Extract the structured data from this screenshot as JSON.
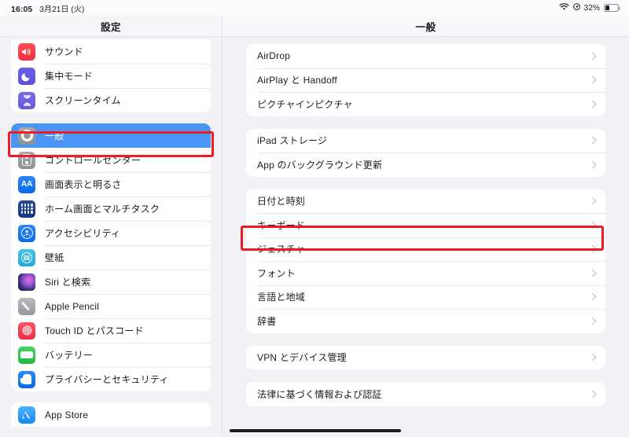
{
  "status_bar": {
    "time": "16:05",
    "date": "3月21日 (火)",
    "wifi_icon": "wifi-icon",
    "location_icon": "location-services-icon",
    "battery_percent": "32%",
    "battery_icon": "battery-icon"
  },
  "header": {
    "sidebar_title": "設定",
    "detail_title": "一般"
  },
  "sidebar": {
    "groups": [
      {
        "items": [
          {
            "label": "サウンド",
            "icon": "speaker-icon",
            "icon_class": "ic-sound",
            "selected": false
          },
          {
            "label": "集中モード",
            "icon": "moon-icon",
            "icon_class": "ic-focus",
            "selected": false
          },
          {
            "label": "スクリーンタイム",
            "icon": "hourglass-icon",
            "icon_class": "ic-screen",
            "selected": false
          }
        ]
      },
      {
        "items": [
          {
            "label": "一般",
            "icon": "gear-icon",
            "icon_class": "ic-general",
            "selected": true
          },
          {
            "label": "コントロールセンター",
            "icon": "control-center-icon",
            "icon_class": "ic-control",
            "selected": false
          },
          {
            "label": "画面表示と明るさ",
            "icon": "display-brightness-icon",
            "icon_class": "ic-display",
            "selected": false
          },
          {
            "label": "ホーム画面とマルチタスク",
            "icon": "home-screen-grid-icon",
            "icon_class": "ic-home",
            "selected": false
          },
          {
            "label": "アクセシビリティ",
            "icon": "accessibility-icon",
            "icon_class": "ic-access",
            "selected": false
          },
          {
            "label": "壁紙",
            "icon": "wallpaper-flower-icon",
            "icon_class": "ic-wall",
            "selected": false
          },
          {
            "label": "Siri と検索",
            "icon": "siri-orb-icon",
            "icon_class": "ic-siri",
            "selected": false
          },
          {
            "label": "Apple Pencil",
            "icon": "pencil-icon",
            "icon_class": "ic-pencil",
            "selected": false
          },
          {
            "label": "Touch ID とパスコード",
            "icon": "fingerprint-icon",
            "icon_class": "ic-touch",
            "selected": false
          },
          {
            "label": "バッテリー",
            "icon": "battery-icon",
            "icon_class": "ic-batt",
            "selected": false
          },
          {
            "label": "プライバシーとセキュリティ",
            "icon": "hand-privacy-icon",
            "icon_class": "ic-privacy",
            "selected": false
          }
        ]
      },
      {
        "items": [
          {
            "label": "App Store",
            "icon": "app-store-icon",
            "icon_class": "ic-appstore",
            "selected": false
          }
        ]
      }
    ]
  },
  "detail": {
    "groups": [
      {
        "rows": [
          {
            "label": "AirDrop",
            "highlighted": false
          },
          {
            "label": "AirPlay と Handoff",
            "highlighted": false
          },
          {
            "label": "ピクチャインピクチャ",
            "highlighted": false
          }
        ]
      },
      {
        "rows": [
          {
            "label": "iPad ストレージ",
            "highlighted": false
          },
          {
            "label": "App のバックグラウンド更新",
            "highlighted": false
          }
        ]
      },
      {
        "rows": [
          {
            "label": "日付と時刻",
            "highlighted": false
          },
          {
            "label": "キーボード",
            "highlighted": true
          },
          {
            "label": "ジェスチャ",
            "highlighted": false
          },
          {
            "label": "フォント",
            "highlighted": false
          },
          {
            "label": "言語と地域",
            "highlighted": false
          },
          {
            "label": "辞書",
            "highlighted": false
          }
        ]
      },
      {
        "rows": [
          {
            "label": "VPN とデバイス管理",
            "highlighted": false
          }
        ]
      },
      {
        "rows": [
          {
            "label": "法律に基づく情報および認証",
            "highlighted": false
          }
        ]
      }
    ]
  },
  "annotations": {
    "highlight_color": "#ec1c24",
    "selection_color": "#4a96f7",
    "general_box_target": "一般",
    "keyboard_box_target": "キーボード"
  },
  "home_indicator": "home-indicator"
}
